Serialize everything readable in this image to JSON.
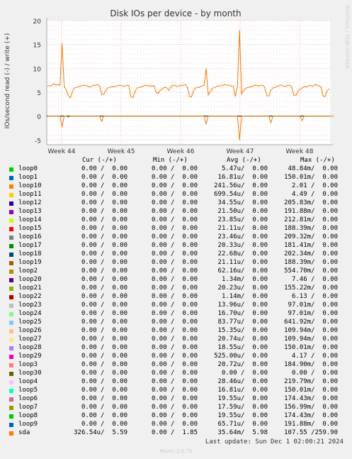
{
  "chart_data": {
    "type": "line",
    "title": "Disk IOs per device - by month",
    "ylabel": "IOs/second read (-) / write (+)",
    "ylim": [
      -6,
      20
    ],
    "yticks": [
      -5,
      0,
      5,
      10,
      15,
      20
    ],
    "xticks": [
      "Week 44",
      "Week 45",
      "Week 46",
      "Week 47",
      "Week 48"
    ],
    "grid": true,
    "series": [
      {
        "name": "sda",
        "color": "#f57900",
        "write": [
          6.2,
          6.4,
          6.3,
          6.8,
          6.5,
          6.6,
          6.4,
          15.3,
          6.3,
          5.5,
          4.3,
          3.8,
          5.2,
          5.9,
          6.0,
          6.2,
          6.3,
          6.4,
          6.5,
          6.3,
          6.1,
          6.2,
          6.5,
          6.4,
          6.6,
          6.3,
          4.5,
          4.6,
          5.4,
          5.9,
          6.0,
          6.2,
          6.1,
          6.3,
          6.4,
          6.5,
          6.3,
          6.2,
          6.5,
          6.4,
          4.0,
          3.9,
          5.2,
          5.9,
          6.0,
          6.1,
          6.3,
          6.5,
          6.3,
          6.4,
          6.2,
          6.4,
          5.0,
          4.7,
          5.4,
          5.7,
          6.0,
          6.0,
          5.4,
          6.0,
          6.4,
          6.5,
          6.2,
          6.3,
          6.5,
          6.4,
          6.6,
          6.1,
          4.1,
          4.0,
          5.4,
          5.9,
          6.0,
          6.1,
          6.3,
          6.4,
          10.0,
          4.4,
          5.2,
          5.8,
          6.0,
          6.2,
          6.4,
          6.3,
          6.5,
          6.6,
          6.4,
          6.5,
          6.3,
          6.2,
          4.1,
          6.3,
          18.0,
          4.6,
          5.4,
          5.8,
          6.0,
          6.1,
          6.2,
          6.4,
          6.5,
          6.3,
          6.4,
          6.5,
          6.1,
          4.3,
          4.2,
          5.4,
          5.9,
          6.0,
          6.2,
          6.4,
          6.5,
          6.3,
          6.2,
          6.4,
          6.5,
          6.1,
          4.4,
          4.3,
          5.3,
          5.6,
          5.9,
          6.2,
          6.1,
          6.3,
          6.4,
          6.2,
          6.6,
          6.5,
          6.3,
          6.1,
          4.2,
          4.1,
          5.4,
          5.7
        ],
        "read": [
          0,
          0,
          0,
          0,
          0,
          0,
          0,
          -2.3,
          0,
          0,
          -0.2,
          0,
          0,
          0,
          0,
          0,
          0,
          0,
          0,
          0,
          0,
          0,
          0,
          0,
          0,
          0,
          -1.1,
          0,
          0,
          0,
          0,
          0,
          0,
          0,
          0,
          0,
          0,
          0,
          0,
          0,
          0,
          0,
          0,
          0,
          0,
          0,
          0,
          0,
          0,
          0,
          0,
          0,
          0,
          0,
          0,
          0,
          0,
          0,
          0,
          0,
          0,
          0,
          0,
          0,
          0,
          0,
          0,
          0,
          0,
          0,
          0,
          0,
          0,
          0,
          0,
          0,
          -1.7,
          0,
          0,
          0,
          0,
          0,
          0,
          0,
          0,
          0,
          0,
          0,
          0,
          0,
          0,
          0,
          -5.0,
          0,
          0,
          0,
          0,
          0,
          0,
          0,
          0,
          0,
          0,
          0,
          0,
          0,
          0,
          -1.4,
          0,
          0,
          0,
          0,
          0,
          0,
          0,
          0,
          0,
          0,
          0,
          0,
          0,
          0,
          -1.0,
          0,
          0,
          0,
          0,
          0,
          0,
          0,
          0,
          0,
          0,
          0,
          0,
          0,
          0,
          0
        ]
      }
    ]
  },
  "legend": {
    "headers": {
      "cur": "Cur (-/+)",
      "min": "Min (-/+)",
      "avg": "Avg (-/+)",
      "max": "Max (-/+)"
    },
    "rows": [
      {
        "name": "loop0",
        "color": "#00cc00",
        "cur": "0.00 /  0.00",
        "min": "0.00 /  0.00",
        "avg": "5.47u/  0.00",
        "max": "48.84m/  0.00"
      },
      {
        "name": "loop1",
        "color": "#0066b3",
        "cur": "0.00 /  0.00",
        "min": "0.00 /  0.00",
        "avg": "16.81u/  0.00",
        "max": "150.01m/  0.00"
      },
      {
        "name": "loop10",
        "color": "#ff8000",
        "cur": "0.00 /  0.00",
        "min": "0.00 /  0.00",
        "avg": "241.56u/  0.00",
        "max": "2.01 /  0.00"
      },
      {
        "name": "loop11",
        "color": "#ffcc00",
        "cur": "0.00 /  0.00",
        "min": "0.00 /  0.00",
        "avg": "699.54u/  0.00",
        "max": "4.49 /  0.00"
      },
      {
        "name": "loop12",
        "color": "#330099",
        "cur": "0.00 /  0.00",
        "min": "0.00 /  0.00",
        "avg": "34.55u/  0.00",
        "max": "205.83m/  0.00"
      },
      {
        "name": "loop13",
        "color": "#990099",
        "cur": "0.00 /  0.00",
        "min": "0.00 /  0.00",
        "avg": "21.50u/  0.00",
        "max": "191.88m/  0.00"
      },
      {
        "name": "loop14",
        "color": "#ccff00",
        "cur": "0.00 /  0.00",
        "min": "0.00 /  0.00",
        "avg": "23.85u/  0.00",
        "max": "212.81m/  0.00"
      },
      {
        "name": "loop15",
        "color": "#ff0000",
        "cur": "0.00 /  0.00",
        "min": "0.00 /  0.00",
        "avg": "21.11u/  0.00",
        "max": "188.39m/  0.00"
      },
      {
        "name": "loop16",
        "color": "#808080",
        "cur": "0.00 /  0.00",
        "min": "0.00 /  0.00",
        "avg": "23.46u/  0.00",
        "max": "209.32m/  0.00"
      },
      {
        "name": "loop17",
        "color": "#008f00",
        "cur": "0.00 /  0.00",
        "min": "0.00 /  0.00",
        "avg": "20.33u/  0.00",
        "max": "181.41m/  0.00"
      },
      {
        "name": "loop18",
        "color": "#00487d",
        "cur": "0.00 /  0.00",
        "min": "0.00 /  0.00",
        "avg": "22.68u/  0.00",
        "max": "202.34m/  0.00"
      },
      {
        "name": "loop19",
        "color": "#b35a00",
        "cur": "0.00 /  0.00",
        "min": "0.00 /  0.00",
        "avg": "21.11u/  0.00",
        "max": "188.39m/  0.00"
      },
      {
        "name": "loop2",
        "color": "#b38f00",
        "cur": "0.00 /  0.00",
        "min": "0.00 /  0.00",
        "avg": "62.16u/  0.00",
        "max": "554.70m/  0.00"
      },
      {
        "name": "loop20",
        "color": "#6b006b",
        "cur": "0.00 /  0.00",
        "min": "0.00 /  0.00",
        "avg": "1.34m/  0.00",
        "max": "7.46 /  0.00"
      },
      {
        "name": "loop21",
        "color": "#8fb300",
        "cur": "0.00 /  0.00",
        "min": "0.00 /  0.00",
        "avg": "20.23u/  0.00",
        "max": "155.22m/  0.00"
      },
      {
        "name": "loop22",
        "color": "#b30000",
        "cur": "0.00 /  0.00",
        "min": "0.00 /  0.00",
        "avg": "1.14m/  0.00",
        "max": "6.13 /  0.00"
      },
      {
        "name": "loop23",
        "color": "#bebebe",
        "cur": "0.00 /  0.00",
        "min": "0.00 /  0.00",
        "avg": "13.96u/  0.00",
        "max": "97.01m/  0.00"
      },
      {
        "name": "loop24",
        "color": "#80ff80",
        "cur": "0.00 /  0.00",
        "min": "0.00 /  0.00",
        "avg": "16.70u/  0.00",
        "max": "97.01m/  0.00"
      },
      {
        "name": "loop25",
        "color": "#80c9ff",
        "cur": "0.00 /  0.00",
        "min": "0.00 /  0.00",
        "avg": "83.77u/  0.00",
        "max": "641.92m/  0.00"
      },
      {
        "name": "loop26",
        "color": "#ffc080",
        "cur": "0.00 /  0.00",
        "min": "0.00 /  0.00",
        "avg": "15.35u/  0.00",
        "max": "109.94m/  0.00"
      },
      {
        "name": "loop27",
        "color": "#ffe680",
        "cur": "0.00 /  0.00",
        "min": "0.00 /  0.00",
        "avg": "20.74u/  0.00",
        "max": "109.94m/  0.00"
      },
      {
        "name": "loop28",
        "color": "#aa80ff",
        "cur": "0.00 /  0.00",
        "min": "0.00 /  0.00",
        "avg": "18.55u/  0.00",
        "max": "150.01m/  0.00"
      },
      {
        "name": "loop29",
        "color": "#ee00cc",
        "cur": "0.00 /  0.00",
        "min": "0.00 /  0.00",
        "avg": "525.00u/  0.00",
        "max": "4.17 /  0.00"
      },
      {
        "name": "loop3",
        "color": "#ff8080",
        "cur": "0.00 /  0.00",
        "min": "0.00 /  0.00",
        "avg": "20.72u/  0.00",
        "max": "184.90m/  0.00"
      },
      {
        "name": "loop30",
        "color": "#666600",
        "cur": "0.00 /  0.00",
        "min": "0.00 /  0.00",
        "avg": "0.00 /  0.00",
        "max": "0.00 /  0.00"
      },
      {
        "name": "loop4",
        "color": "#ffbfff",
        "cur": "0.00 /  0.00",
        "min": "0.00 /  0.00",
        "avg": "28.46u/  0.00",
        "max": "219.79m/  0.00"
      },
      {
        "name": "loop5",
        "color": "#00ffcc",
        "cur": "0.00 /  0.00",
        "min": "0.00 /  0.00",
        "avg": "16.81u/  0.00",
        "max": "150.01m/  0.00"
      },
      {
        "name": "loop6",
        "color": "#cc6699",
        "cur": "0.00 /  0.00",
        "min": "0.00 /  0.00",
        "avg": "19.55u/  0.00",
        "max": "174.43m/  0.00"
      },
      {
        "name": "loop7",
        "color": "#999900",
        "cur": "0.00 /  0.00",
        "min": "0.00 /  0.00",
        "avg": "17.59u/  0.00",
        "max": "156.99m/  0.00"
      },
      {
        "name": "loop8",
        "color": "#00cc00",
        "cur": "0.00 /  0.00",
        "min": "0.00 /  0.00",
        "avg": "19.55u/  0.00",
        "max": "174.43m/  0.00"
      },
      {
        "name": "loop9",
        "color": "#0066b3",
        "cur": "0.00 /  0.00",
        "min": "0.00 /  0.00",
        "avg": "65.71u/  0.00",
        "max": "191.88m/  0.00"
      },
      {
        "name": "sda",
        "color": "#ff8000",
        "cur": "326.54u/  5.59",
        "min": "0.00 /  1.85",
        "avg": "35.64m/  5.98",
        "max": "107.55 /259.90"
      }
    ]
  },
  "footer": {
    "last_update": "Last update: Sun Dec  1 02:00:21 2024",
    "version": "Munin 2.0.75",
    "side_label": "RRDTOOL / TOBI OETIKER"
  }
}
